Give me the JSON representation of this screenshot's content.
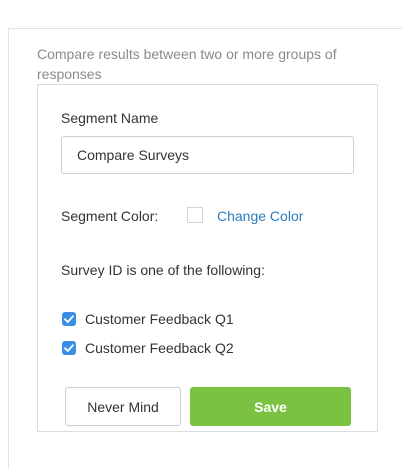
{
  "description": "Compare results between two or more groups of responses",
  "segment": {
    "name_label": "Segment Name",
    "name_value": "Compare Surveys",
    "color_label": "Segment Color:",
    "change_color_label": "Change Color",
    "swatch_color": "#ffffff"
  },
  "filter": {
    "label": "Survey ID is one of the following:",
    "options": [
      {
        "label": "Customer Feedback Q1",
        "checked": true
      },
      {
        "label": "Customer Feedback Q2",
        "checked": true
      }
    ]
  },
  "actions": {
    "cancel_label": "Never Mind",
    "save_label": "Save"
  },
  "colors": {
    "accent": "#2b7dc0",
    "checkbox": "#3a8ee6",
    "save": "#7bc242"
  }
}
